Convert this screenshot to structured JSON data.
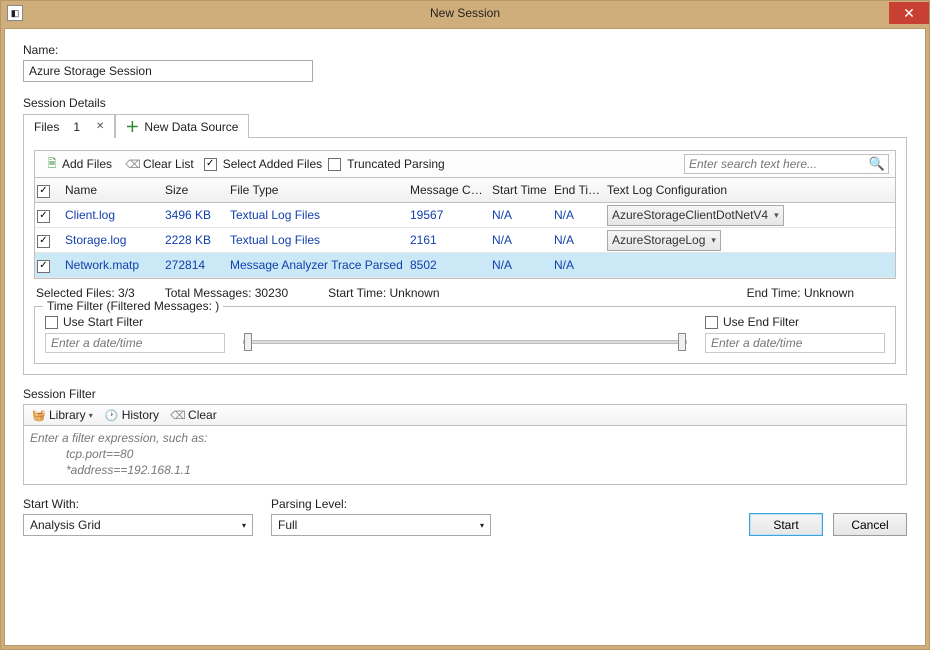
{
  "window": {
    "title": "New Session"
  },
  "name": {
    "label": "Name:",
    "value": "Azure Storage Session"
  },
  "sessionDetails": {
    "label": "Session Details",
    "tabs": {
      "files_label": "Files",
      "files_count": "1",
      "new_source": "New Data Source"
    },
    "toolbar": {
      "add_files": "Add Files",
      "clear_list": "Clear List",
      "select_added_label": "Select Added Files",
      "truncated_label": "Truncated Parsing",
      "search_placeholder": "Enter search text here..."
    },
    "columns": {
      "name": "Name",
      "size": "Size",
      "type": "File Type",
      "count": "Message Count",
      "start": "Start Time",
      "end": "End Time",
      "conf": "Text Log Configuration"
    },
    "rows": [
      {
        "name": "Client.log",
        "size": "3496 KB",
        "type": "Textual Log Files",
        "count": "19567",
        "start": "N/A",
        "end": "N/A",
        "conf": "AzureStorageClientDotNetV4",
        "selected": false,
        "hasConf": true
      },
      {
        "name": "Storage.log",
        "size": "2228 KB",
        "type": "Textual Log Files",
        "count": "2161",
        "start": "N/A",
        "end": "N/A",
        "conf": "AzureStorageLog",
        "selected": false,
        "hasConf": true
      },
      {
        "name": "Network.matp",
        "size": "272814",
        "type": "Message Analyzer Trace Parsed",
        "count": "8502",
        "start": "N/A",
        "end": "N/A",
        "conf": "",
        "selected": true,
        "hasConf": false
      }
    ],
    "status": {
      "selected_files": "Selected Files: 3/3",
      "total_messages": "Total Messages: 30230",
      "start_time": "Start Time: Unknown",
      "end_time": "End Time: Unknown"
    },
    "timeFilter": {
      "legend": "Time Filter (Filtered Messages:  )",
      "use_start": "Use Start Filter",
      "use_end": "Use End Filter",
      "placeholder": "Enter a date/time"
    }
  },
  "sessionFilter": {
    "label": "Session Filter",
    "library": "Library",
    "history": "History",
    "clear": "Clear",
    "hint_line1": "Enter a filter expression, such as:",
    "hint_line2": "tcp.port==80",
    "hint_line3": "*address==192.168.1.1"
  },
  "bottom": {
    "start_with_label": "Start With:",
    "start_with_value": "Analysis Grid",
    "parsing_label": "Parsing Level:",
    "parsing_value": "Full",
    "start_btn": "Start",
    "cancel_btn": "Cancel"
  }
}
